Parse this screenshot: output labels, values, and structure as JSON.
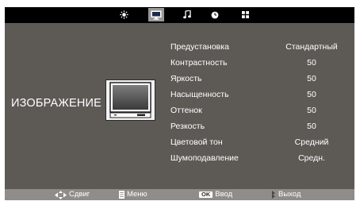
{
  "tabs": [
    {
      "name": "brightness-sun-icon",
      "active": false
    },
    {
      "name": "picture-tv-icon",
      "active": true
    },
    {
      "name": "sound-note-icon",
      "active": false
    },
    {
      "name": "time-clock-icon",
      "active": false
    },
    {
      "name": "options-icon",
      "active": false
    }
  ],
  "section": {
    "title": "ИЗОБРАЖЕНИЕ",
    "illustration_icon": "tv-screen-icon"
  },
  "settings": [
    {
      "label": "Предустановка",
      "value": "Стандартный"
    },
    {
      "label": "Контрастность",
      "value": "50"
    },
    {
      "label": "Яркость",
      "value": "50"
    },
    {
      "label": "Насыщенность",
      "value": "50"
    },
    {
      "label": "Оттенок",
      "value": "50"
    },
    {
      "label": "Резкость",
      "value": "50"
    },
    {
      "label": "Цветовой тон",
      "value": "Средний"
    },
    {
      "label": "Шумоподавление",
      "value": "Средн."
    }
  ],
  "hints": {
    "move": {
      "icon": "dpad-arrows-icon",
      "label": "Сдвиг"
    },
    "menu": {
      "icon": "menu-icon",
      "label": "Меню"
    },
    "enter": {
      "badge": "OK",
      "label": "Ввод"
    },
    "exit": {
      "icon": "exit-icon",
      "label": "Выход"
    }
  },
  "colors": {
    "panel_bg": "#5d5a56",
    "topbar_bg": "#000000",
    "active_tab_bg": "#9a9896",
    "bottombar_bg": "#8f8c89",
    "text": "#ffffff"
  }
}
